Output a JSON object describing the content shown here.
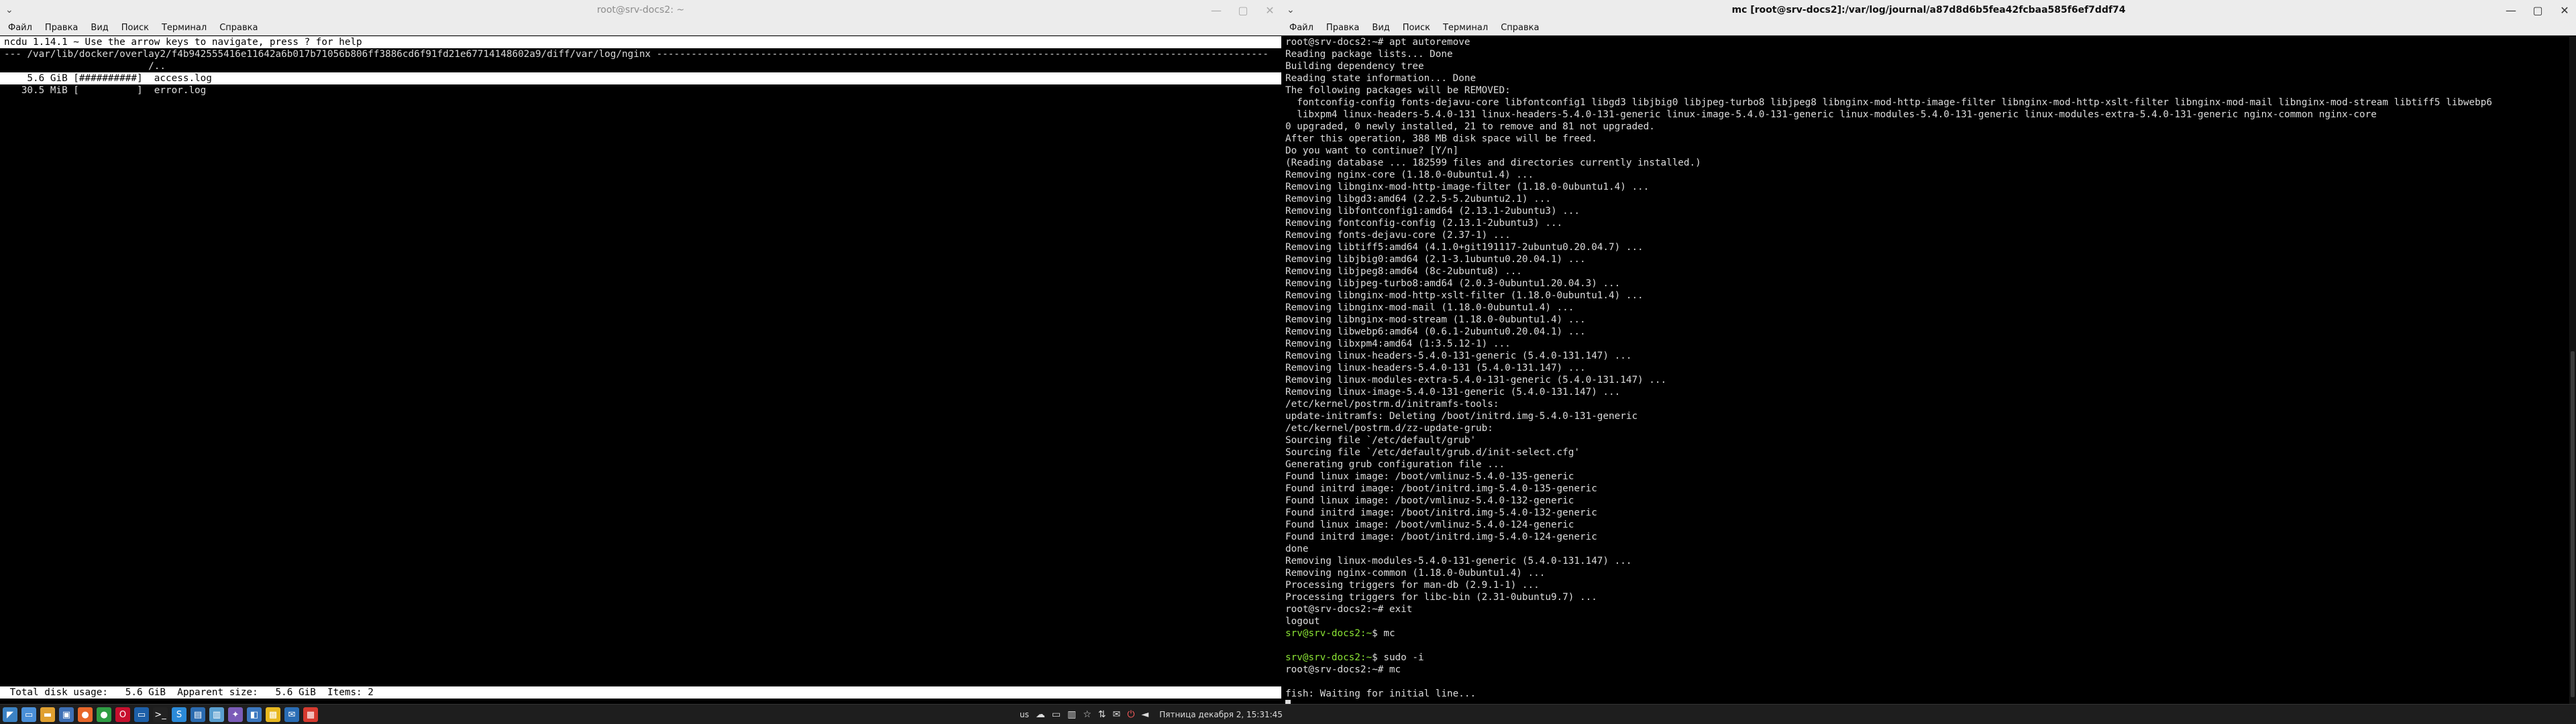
{
  "left_window": {
    "title": "root@srv-docs2: ~",
    "menu": [
      "Файл",
      "Правка",
      "Вид",
      "Поиск",
      "Терминал",
      "Справка"
    ],
    "ncdu": {
      "header": "ncdu 1.14.1 ~ Use the arrow keys to navigate, press ? for help",
      "path": "--- /var/lib/docker/overlay2/f4b942555416e11642a6b017b71056b806ff3886cd6f91fd21e67714148602a9/diff/var/log/nginx ----------------------------------------------------------------------------------------------------------",
      "parent": "                         /..",
      "rows": [
        {
          "text": "    5.6 GiB [##########]  access.log",
          "selected": true
        },
        {
          "text": "   30.5 MiB [          ]  error.log",
          "selected": false
        }
      ],
      "footer": " Total disk usage:   5.6 GiB  Apparent size:   5.6 GiB  Items: 2"
    }
  },
  "right_window": {
    "title": "mc [root@srv-docs2]:/var/log/journal/a87d8d6b5fea42fcbaa585f6ef7ddf74",
    "menu": [
      "Файл",
      "Правка",
      "Вид",
      "Поиск",
      "Терминал",
      "Справка"
    ],
    "lines": [
      {
        "text": "root@srv-docs2:~# apt autoremove"
      },
      {
        "text": "Reading package lists... Done"
      },
      {
        "text": "Building dependency tree"
      },
      {
        "text": "Reading state information... Done"
      },
      {
        "text": "The following packages will be REMOVED:"
      },
      {
        "text": "  fontconfig-config fonts-dejavu-core libfontconfig1 libgd3 libjbig0 libjpeg-turbo8 libjpeg8 libnginx-mod-http-image-filter libnginx-mod-http-xslt-filter libnginx-mod-mail libnginx-mod-stream libtiff5 libwebp6"
      },
      {
        "text": "  libxpm4 linux-headers-5.4.0-131 linux-headers-5.4.0-131-generic linux-image-5.4.0-131-generic linux-modules-5.4.0-131-generic linux-modules-extra-5.4.0-131-generic nginx-common nginx-core"
      },
      {
        "text": "0 upgraded, 0 newly installed, 21 to remove and 81 not upgraded."
      },
      {
        "text": "After this operation, 388 MB disk space will be freed."
      },
      {
        "text": "Do you want to continue? [Y/n]"
      },
      {
        "text": "(Reading database ... 182599 files and directories currently installed.)"
      },
      {
        "text": "Removing nginx-core (1.18.0-0ubuntu1.4) ..."
      },
      {
        "text": "Removing libnginx-mod-http-image-filter (1.18.0-0ubuntu1.4) ..."
      },
      {
        "text": "Removing libgd3:amd64 (2.2.5-5.2ubuntu2.1) ..."
      },
      {
        "text": "Removing libfontconfig1:amd64 (2.13.1-2ubuntu3) ..."
      },
      {
        "text": "Removing fontconfig-config (2.13.1-2ubuntu3) ..."
      },
      {
        "text": "Removing fonts-dejavu-core (2.37-1) ..."
      },
      {
        "text": "Removing libtiff5:amd64 (4.1.0+git191117-2ubuntu0.20.04.7) ..."
      },
      {
        "text": "Removing libjbig0:amd64 (2.1-3.1ubuntu0.20.04.1) ..."
      },
      {
        "text": "Removing libjpeg8:amd64 (8c-2ubuntu8) ..."
      },
      {
        "text": "Removing libjpeg-turbo8:amd64 (2.0.3-0ubuntu1.20.04.3) ..."
      },
      {
        "text": "Removing libnginx-mod-http-xslt-filter (1.18.0-0ubuntu1.4) ..."
      },
      {
        "text": "Removing libnginx-mod-mail (1.18.0-0ubuntu1.4) ..."
      },
      {
        "text": "Removing libnginx-mod-stream (1.18.0-0ubuntu1.4) ..."
      },
      {
        "text": "Removing libwebp6:amd64 (0.6.1-2ubuntu0.20.04.1) ..."
      },
      {
        "text": "Removing libxpm4:amd64 (1:3.5.12-1) ..."
      },
      {
        "text": "Removing linux-headers-5.4.0-131-generic (5.4.0-131.147) ..."
      },
      {
        "text": "Removing linux-headers-5.4.0-131 (5.4.0-131.147) ..."
      },
      {
        "text": "Removing linux-modules-extra-5.4.0-131-generic (5.4.0-131.147) ..."
      },
      {
        "text": "Removing linux-image-5.4.0-131-generic (5.4.0-131.147) ..."
      },
      {
        "text": "/etc/kernel/postrm.d/initramfs-tools:"
      },
      {
        "text": "update-initramfs: Deleting /boot/initrd.img-5.4.0-131-generic"
      },
      {
        "text": "/etc/kernel/postrm.d/zz-update-grub:"
      },
      {
        "text": "Sourcing file `/etc/default/grub'"
      },
      {
        "text": "Sourcing file `/etc/default/grub.d/init-select.cfg'"
      },
      {
        "text": "Generating grub configuration file ..."
      },
      {
        "text": "Found linux image: /boot/vmlinuz-5.4.0-135-generic"
      },
      {
        "text": "Found initrd image: /boot/initrd.img-5.4.0-135-generic"
      },
      {
        "text": "Found linux image: /boot/vmlinuz-5.4.0-132-generic"
      },
      {
        "text": "Found initrd image: /boot/initrd.img-5.4.0-132-generic"
      },
      {
        "text": "Found linux image: /boot/vmlinuz-5.4.0-124-generic"
      },
      {
        "text": "Found initrd image: /boot/initrd.img-5.4.0-124-generic"
      },
      {
        "text": "done"
      },
      {
        "text": "Removing linux-modules-5.4.0-131-generic (5.4.0-131.147) ..."
      },
      {
        "text": "Removing nginx-common (1.18.0-0ubuntu1.4) ..."
      },
      {
        "text": "Processing triggers for man-db (2.9.1-1) ..."
      },
      {
        "text": "Processing triggers for libc-bin (2.31-0ubuntu9.7) ..."
      },
      {
        "text": "root@srv-docs2:~# exit"
      },
      {
        "text": "logout"
      },
      {
        "text": "srv@srv-docs2:~$ mc",
        "prompt": "srv@srv-docs2:~",
        "rest": "$ mc"
      },
      {
        "text": ""
      },
      {
        "text": "srv@srv-docs2:~$ sudo -i",
        "prompt": "srv@srv-docs2:~",
        "rest": "$ sudo -i"
      },
      {
        "text": "root@srv-docs2:~# mc"
      },
      {
        "text": ""
      },
      {
        "text": "fish: Waiting for initial line..."
      }
    ]
  },
  "taskbar": {
    "apps": [
      {
        "name": "start-menu-icon",
        "glyph": "◤",
        "color": "#3b82c4"
      },
      {
        "name": "file-manager-icon",
        "glyph": "▭",
        "color": "#4a8fd8"
      },
      {
        "name": "folder-icon",
        "glyph": "▬",
        "color": "#e0a030"
      },
      {
        "name": "screen-icon",
        "glyph": "▣",
        "color": "#3d6fb5"
      },
      {
        "name": "firefox-icon",
        "glyph": "●",
        "color": "#e8672a"
      },
      {
        "name": "chrome-icon",
        "glyph": "●",
        "color": "#2f9e44"
      },
      {
        "name": "opera-icon",
        "glyph": "O",
        "color": "#c8102e"
      },
      {
        "name": "terminal-icon",
        "glyph": "▭",
        "color": "#1d5fa8"
      },
      {
        "name": "terminal-active-icon",
        "glyph": ">_",
        "color": "#222"
      },
      {
        "name": "skype-icon",
        "glyph": "S",
        "color": "#2b8ad8"
      },
      {
        "name": "files-icon",
        "glyph": "▤",
        "color": "#2b6bb0"
      },
      {
        "name": "app-icon",
        "glyph": "▥",
        "color": "#5a9fd0"
      },
      {
        "name": "evolution-icon",
        "glyph": "✦",
        "color": "#7b5cb8"
      },
      {
        "name": "network-icon",
        "glyph": "◧",
        "color": "#3c78c0"
      },
      {
        "name": "notes-icon",
        "glyph": "▩",
        "color": "#e8b820"
      },
      {
        "name": "mail-icon",
        "glyph": "✉",
        "color": "#2a6db5"
      },
      {
        "name": "table-icon",
        "glyph": "▦",
        "color": "#d63a2f"
      }
    ],
    "tray": {
      "lang": "us",
      "clock": "Пятница декабря  2, 15:31:45"
    }
  }
}
